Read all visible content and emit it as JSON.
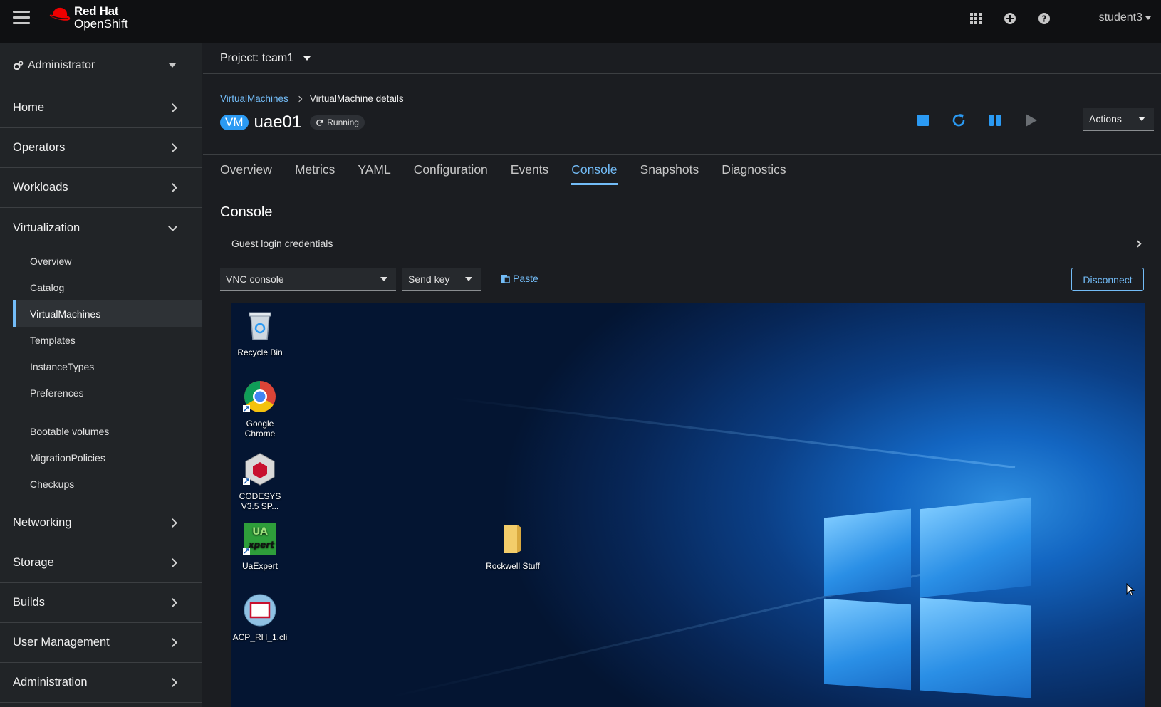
{
  "masthead": {
    "brand_line1": "Red Hat",
    "brand_line2": "OpenShift",
    "user": "student3",
    "icons": [
      "grid-icon",
      "plus-circle-icon",
      "help-icon"
    ]
  },
  "sidebar": {
    "perspective": "Administrator",
    "sections_top": [
      "Home",
      "Operators",
      "Workloads"
    ],
    "virtualization": {
      "label": "Virtualization",
      "items": [
        "Overview",
        "Catalog",
        "VirtualMachines",
        "Templates",
        "InstanceTypes",
        "Preferences"
      ],
      "items2": [
        "Bootable volumes",
        "MigrationPolicies",
        "Checkups"
      ],
      "active": "VirtualMachines"
    },
    "sections_bottom": [
      "Networking",
      "Storage",
      "Builds",
      "User Management",
      "Administration"
    ]
  },
  "project": {
    "label": "Project: team1"
  },
  "header": {
    "breadcrumb_link": "VirtualMachines",
    "breadcrumb_current": "VirtualMachine details",
    "badge": "VM",
    "name": "uae01",
    "status": "Running",
    "actions_label": "Actions",
    "colors": {
      "accent": "#73bcf7",
      "badge": "#2b9af3",
      "action_icon": "#2b9af3"
    }
  },
  "tabs": [
    "Overview",
    "Metrics",
    "YAML",
    "Configuration",
    "Events",
    "Console",
    "Snapshots",
    "Diagnostics"
  ],
  "active_tab": "Console",
  "console": {
    "title": "Console",
    "credentials_label": "Guest login credentials",
    "console_type": "VNC console",
    "send_key": "Send key",
    "paste": "Paste",
    "disconnect": "Disconnect"
  },
  "desktop": {
    "icons": [
      {
        "label": "Recycle Bin",
        "icon": "recycle-bin-icon"
      },
      {
        "label": "Google Chrome",
        "icon": "chrome-icon"
      },
      {
        "label": "CODESYS V3.5 SP...",
        "icon": "codesys-icon"
      },
      {
        "label": "UaExpert",
        "icon": "uaexpert-icon"
      },
      {
        "label": "ACP_RH_1.cli",
        "icon": "acp-file-icon"
      },
      {
        "label": "Rockwell Stuff",
        "icon": "folder-icon"
      }
    ]
  }
}
